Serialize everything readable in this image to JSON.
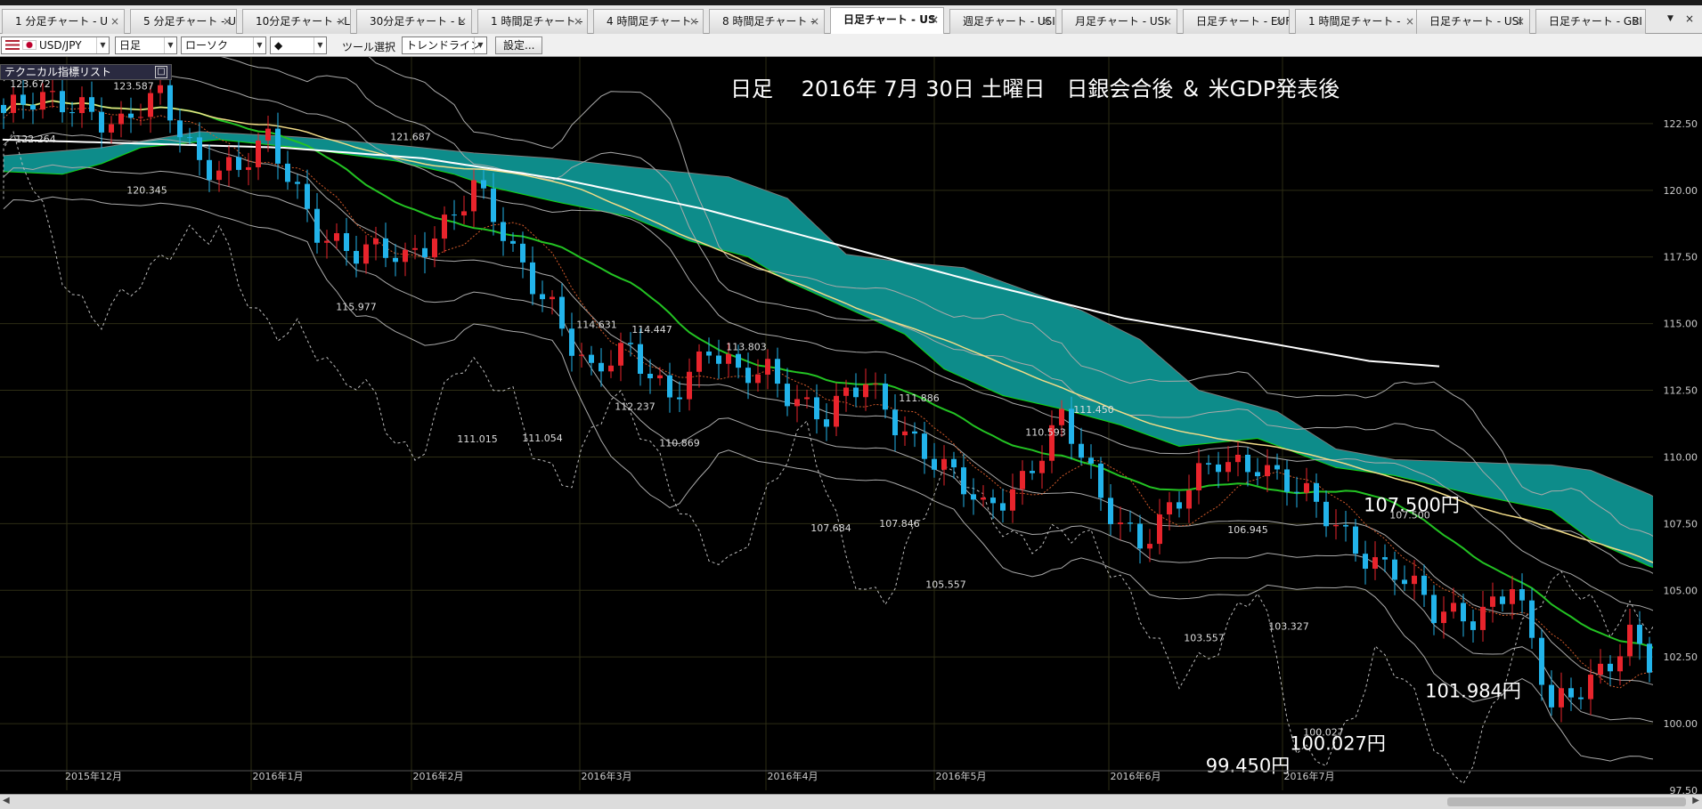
{
  "tabs": [
    {
      "label": "1 分足チャート - U",
      "active": false
    },
    {
      "label": "5 分足チャート - U",
      "active": false
    },
    {
      "label": "10分足チャート - L",
      "active": false
    },
    {
      "label": "30分足チャート - L",
      "active": false
    },
    {
      "label": "1 時間足チャート -",
      "active": false
    },
    {
      "label": "4 時間足チャート -",
      "active": false
    },
    {
      "label": "8 時間足チャート -",
      "active": false
    },
    {
      "label": "日足チャート - US",
      "active": true
    },
    {
      "label": "週足チャート - USI",
      "active": false
    },
    {
      "label": "月足チャート - USI",
      "active": false
    },
    {
      "label": "日足チャート - EUF",
      "active": false
    },
    {
      "label": "1 時間足チャート -",
      "active": false
    },
    {
      "label": "日足チャート - USI",
      "active": false
    },
    {
      "label": "日足チャート - GBI",
      "active": false
    }
  ],
  "tab_close_glyph": "×",
  "tab_nav": {
    "down": "▼",
    "close": "×"
  },
  "toolbar": {
    "symbol": "USD/JPY",
    "timeframe": "日足",
    "chart_type": "ローソク",
    "candle_glyph": "◆",
    "tool_label": "ツール選択",
    "tool_value": "トレンドライン",
    "settings": "設定..."
  },
  "technical_list": {
    "label": "テクニカル指標リスト",
    "icon": "□"
  },
  "scroll": {
    "left": "◀",
    "right": "▶"
  },
  "chart_data": {
    "type": "candlestick",
    "title": "日足　 2016年 7月 30日 土曜日　日銀会合後 ＆ 米GDP発表後",
    "symbol": "USD/JPY",
    "y_range": [
      97.5,
      125.0
    ],
    "y_ticks": [
      "100.00",
      "102.50",
      "105.00",
      "107.50",
      "110.00",
      "112.50",
      "115.00",
      "117.50",
      "120.00",
      "122.50"
    ],
    "x_labels": [
      "2015年12月",
      "2016年1月",
      "2016年2月",
      "2016年3月",
      "2016年4月",
      "2016年5月",
      "2016年6月",
      "2016年7月"
    ],
    "candle_labels": [
      "123.672",
      "123.587",
      "122.264",
      "120.345",
      "121.687",
      "115.977",
      "114.631",
      "114.447",
      "112.237",
      "111.015",
      "111.054",
      "113.803",
      "110.869",
      "111.886",
      "110.593",
      "111.450",
      "107.684",
      "107.846",
      "105.557",
      "106.945",
      "103.327",
      "103.557",
      "107.500",
      "100.027"
    ],
    "annotations": [
      "107.500円",
      "101.984円",
      "100.027円",
      "99.450円"
    ],
    "grid": true,
    "last_close": 101.984,
    "period_high": 107.5,
    "period_low": 99.45,
    "colors": {
      "background": "#000000",
      "bull": "#e8242c",
      "bear": "#22b3ea",
      "cloud": "#0d8c8a",
      "cloud_edge": "#12d812",
      "ma_short": "#23c323",
      "ma_mid": "#f2dc88",
      "ma_long": "#ffffff",
      "band": "#aaaaaa",
      "lagging": "#bdbdbd"
    }
  }
}
